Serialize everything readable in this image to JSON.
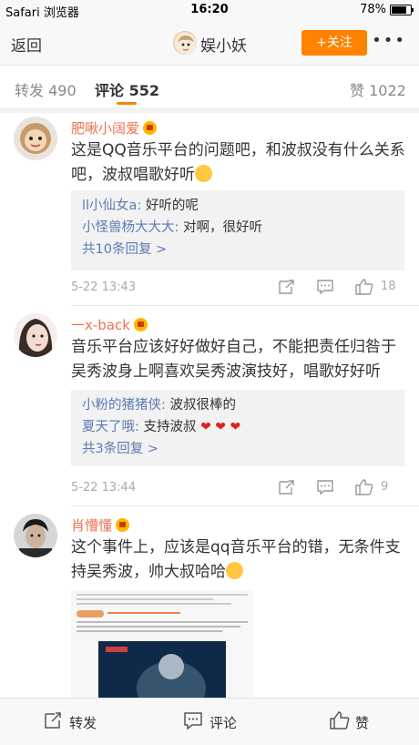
{
  "status_bar": {
    "carrier": "Safari 浏览器",
    "time": "16:20",
    "battery": "78%",
    "battery_level": 0.78
  },
  "nav": {
    "back_label": "返回",
    "title": "娱小妖",
    "follow_label": "+关注",
    "more_label": "•••"
  },
  "tabs": [
    {
      "label": "转发 490"
    },
    {
      "label": "评论 552"
    },
    {
      "label": "赞 1022"
    }
  ],
  "comments": [
    {
      "name": "肥啾小阔爱",
      "text": "这是QQ音乐平台的问题吧，和波叔没有什么关系吧，波叔唱歌好听",
      "replies": [
        {
          "name": "ll小仙女a:",
          "text": " 好听的呢"
        },
        {
          "name": "小怪兽杨大大大:",
          "text": " 对啊，很好听"
        }
      ],
      "more_replies": "共10条回复 >",
      "date": "5-22 13:43",
      "likes": "18"
    },
    {
      "name": "一x-back",
      "text": "音乐平台应该好好做好自己，不能把责任归咎于吴秀波身上啊喜欢吴秀波演技好，唱歌好好听",
      "replies": [
        {
          "name": "小粉的猪猪侠:",
          "text": " 波叔很棒的"
        },
        {
          "name": "夏天了哦:",
          "text": " 支持波叔"
        }
      ],
      "more_replies": "共3条回复 >",
      "date": "5-22 13:44",
      "likes": "9"
    },
    {
      "name": "肖懵懂",
      "text": "这个事件上，应该是qq音乐平台的错，无条件支持吴秀波，帅大叔哈哈"
    }
  ],
  "bottom_bar": {
    "repost": "转发",
    "comment": "评论",
    "like": "赞"
  }
}
